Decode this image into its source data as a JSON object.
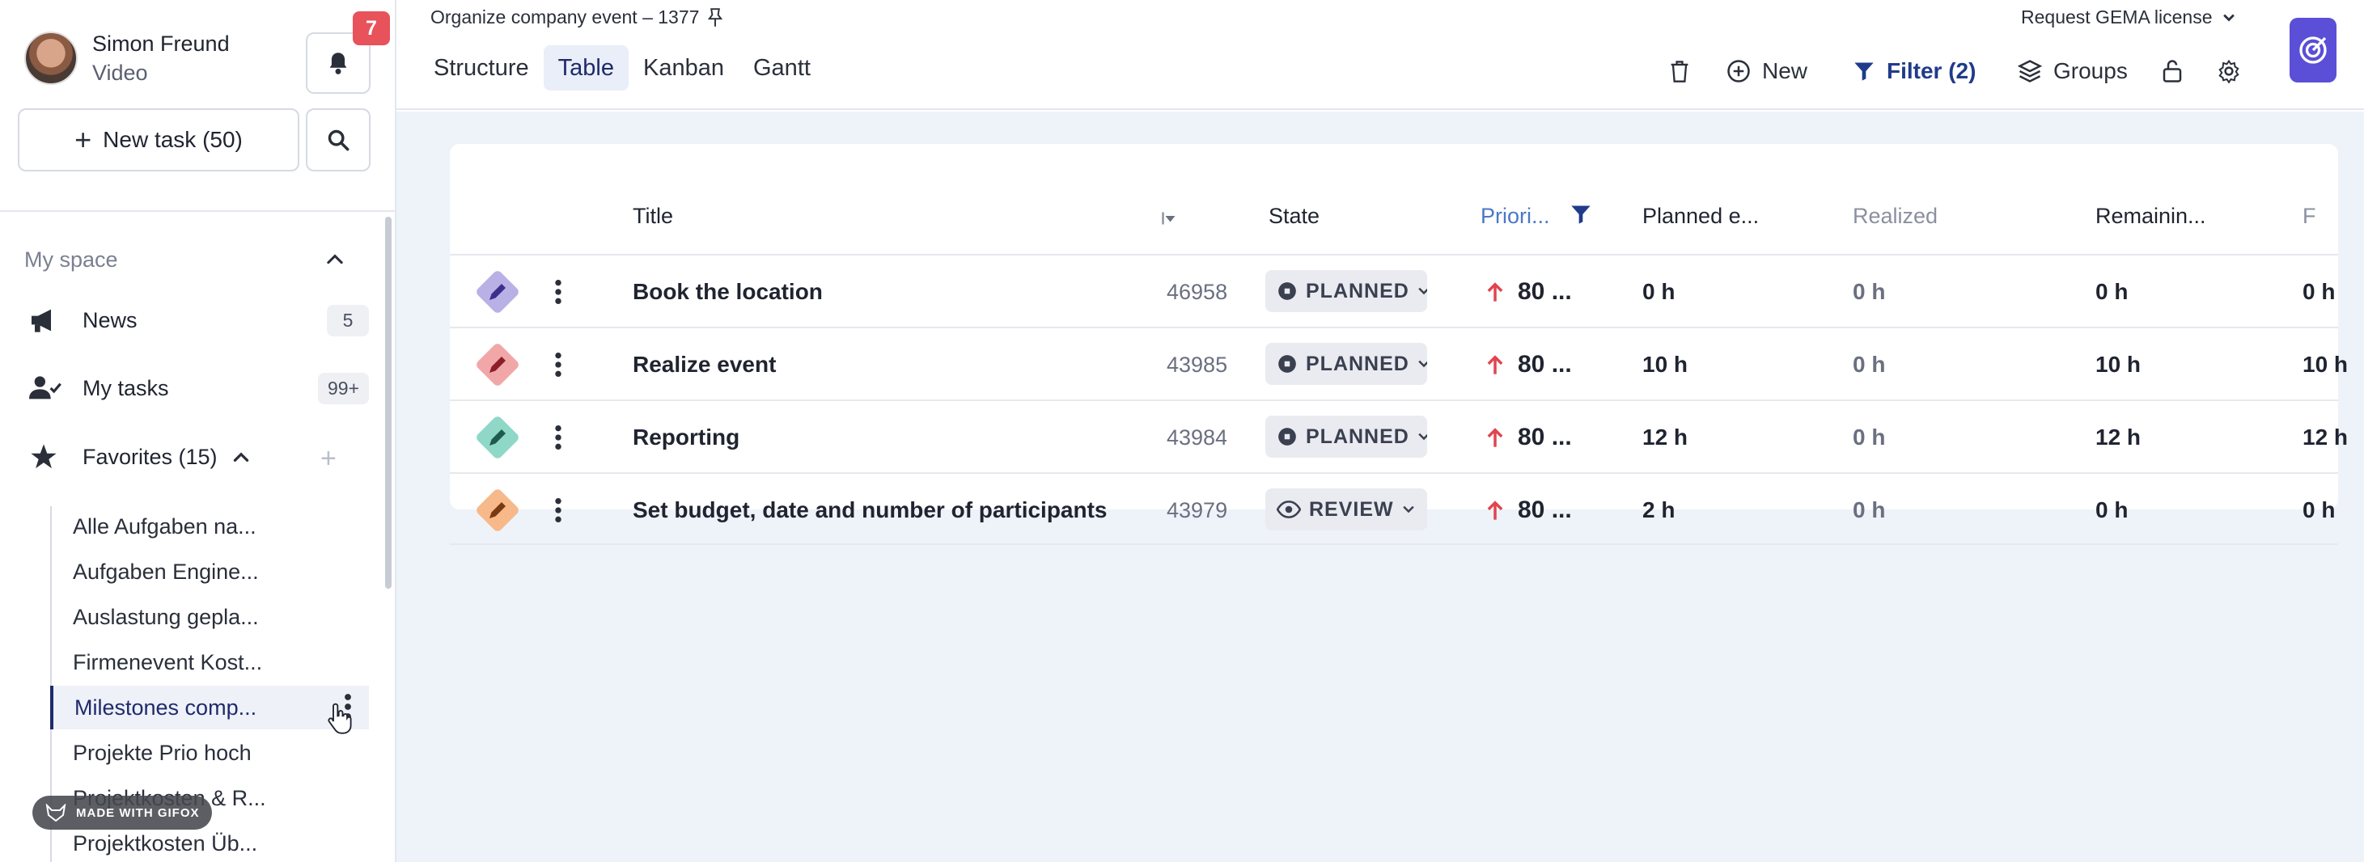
{
  "user": {
    "name": "Simon Freund",
    "role": "Video"
  },
  "notifications": {
    "count": "7"
  },
  "sidebar": {
    "new_task_label": "New task (50)",
    "section_title": "My space",
    "nav": [
      {
        "label": "News",
        "count": "5"
      },
      {
        "label": "My tasks",
        "count": "99+"
      },
      {
        "label": "Favorites (15)"
      }
    ],
    "favorites": [
      "Alle Aufgaben na...",
      "Aufgaben Engine...",
      "Auslastung gepla...",
      "Firmenevent Kost...",
      "Milestones comp...",
      "Projekte Prio hoch",
      "Projektkosten & R...",
      "Projektkosten Üb..."
    ],
    "watermark": "MADE WITH GIFOX"
  },
  "header": {
    "breadcrumb": "Organize company event – 1377",
    "tabs": [
      "Structure",
      "Table",
      "Kanban",
      "Gantt"
    ],
    "active_tab": "Table",
    "request_label": "Request GEMA license",
    "toolbar": {
      "new_label": "New",
      "filter_label": "Filter (2)",
      "groups_label": "Groups"
    }
  },
  "table": {
    "columns": [
      "Title",
      "State",
      "Priori...",
      "Planned e...",
      "Realized",
      "Remainin...",
      "F"
    ],
    "rows": [
      {
        "title": "Book the location",
        "id": "46958",
        "state": "PLANNED",
        "priority": "80 ...",
        "planned": "0 h",
        "realized": "0 h",
        "remaining": "0 h",
        "f": "0 h",
        "color": "#b9b0e6"
      },
      {
        "title": "Realize event",
        "id": "43985",
        "state": "PLANNED",
        "priority": "80 ...",
        "planned": "10 h",
        "realized": "0 h",
        "remaining": "10 h",
        "f": "10 h",
        "color": "#f1a7a8"
      },
      {
        "title": "Reporting",
        "id": "43984",
        "state": "PLANNED",
        "priority": "80 ...",
        "planned": "12 h",
        "realized": "0 h",
        "remaining": "12 h",
        "f": "12 h",
        "color": "#8fd8c7"
      },
      {
        "title": "Set budget, date and number of participants",
        "id": "43979",
        "state": "REVIEW",
        "priority": "80 ...",
        "planned": "2 h",
        "realized": "0 h",
        "remaining": "0 h",
        "f": "0 h",
        "color": "#f7b98a"
      }
    ]
  },
  "colors": {
    "accent": "#1f3b8a",
    "priority_arrow": "#e0454f",
    "badge": "#e8525a",
    "launcher": "#5a4fd6"
  }
}
